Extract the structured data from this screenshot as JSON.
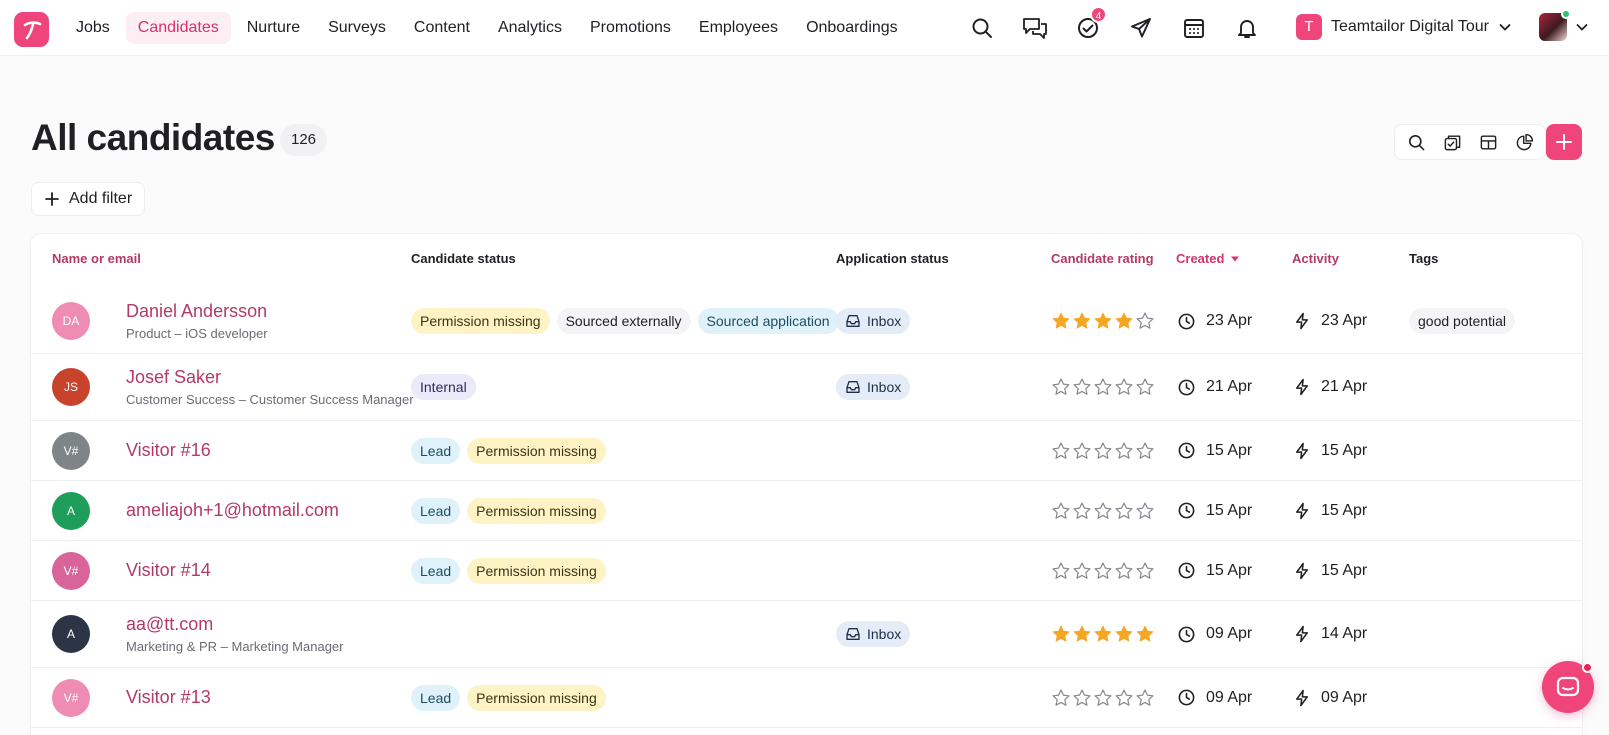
{
  "nav": {
    "items": [
      {
        "label": "Jobs",
        "active": false
      },
      {
        "label": "Candidates",
        "active": true
      },
      {
        "label": "Nurture",
        "active": false
      },
      {
        "label": "Surveys",
        "active": false
      },
      {
        "label": "Content",
        "active": false
      },
      {
        "label": "Analytics",
        "active": false
      },
      {
        "label": "Promotions",
        "active": false
      },
      {
        "label": "Employees",
        "active": false
      },
      {
        "label": "Onboardings",
        "active": false
      }
    ],
    "icons": [
      "search-icon",
      "messages-icon",
      "tasks-icon",
      "send-icon",
      "calendar-icon",
      "bell-icon"
    ],
    "tasks_badge": "4",
    "company_initial": "T",
    "company_name": "Teamtailor Digital Tour"
  },
  "page": {
    "title": "All candidates",
    "count": "126",
    "add_filter_label": "Add filter"
  },
  "colors": {
    "brand": "#f0457a",
    "accent_text": "#b33a62",
    "star_filled": "#f5a623"
  },
  "table": {
    "headers": {
      "name": "Name or email",
      "candidate_status": "Candidate status",
      "application_status": "Application status",
      "rating": "Candidate rating",
      "created": "Created",
      "activity": "Activity",
      "tags": "Tags"
    },
    "rows": [
      {
        "initials": "DA",
        "avatar_color": "#ee8cb3",
        "name": "Daniel Andersson",
        "sub": "Product – iOS developer",
        "statuses": [
          {
            "label": "Permission missing",
            "style": "yellow"
          },
          {
            "label": "Sourced externally",
            "style": "grey"
          },
          {
            "label": "Sourced application",
            "style": "cyan"
          }
        ],
        "application": "Inbox",
        "rating": 4,
        "created": "23 Apr",
        "activity": "23 Apr",
        "tag": "good potential"
      },
      {
        "initials": "JS",
        "avatar_color": "#c8432c",
        "name": "Josef Saker",
        "sub": "Customer Success – Customer Success Manager",
        "statuses": [
          {
            "label": "Internal",
            "style": "purple"
          }
        ],
        "application": "Inbox",
        "rating": 0,
        "created": "21 Apr",
        "activity": "21 Apr",
        "tag": ""
      },
      {
        "initials": "V#",
        "avatar_color": "#7e8587",
        "name": "Visitor #16",
        "sub": "",
        "statuses": [
          {
            "label": "Lead",
            "style": "cyan"
          },
          {
            "label": "Permission missing",
            "style": "yellow"
          }
        ],
        "application": "",
        "rating": 0,
        "created": "15 Apr",
        "activity": "15 Apr",
        "tag": ""
      },
      {
        "initials": "A",
        "avatar_color": "#1e9e5a",
        "name": "ameliajoh+1@hotmail.com",
        "sub": "",
        "statuses": [
          {
            "label": "Lead",
            "style": "cyan"
          },
          {
            "label": "Permission missing",
            "style": "yellow"
          }
        ],
        "application": "",
        "rating": 0,
        "created": "15 Apr",
        "activity": "15 Apr",
        "tag": ""
      },
      {
        "initials": "V#",
        "avatar_color": "#d9649a",
        "name": "Visitor #14",
        "sub": "",
        "statuses": [
          {
            "label": "Lead",
            "style": "cyan"
          },
          {
            "label": "Permission missing",
            "style": "yellow"
          }
        ],
        "application": "",
        "rating": 0,
        "created": "15 Apr",
        "activity": "15 Apr",
        "tag": ""
      },
      {
        "initials": "A",
        "avatar_color": "#2c3546",
        "name": "aa@tt.com",
        "sub": "Marketing & PR – Marketing Manager",
        "statuses": [],
        "application": "Inbox",
        "rating": 5,
        "created": "09 Apr",
        "activity": "14 Apr",
        "tag": ""
      },
      {
        "initials": "V#",
        "avatar_color": "#ee8cb3",
        "name": "Visitor #13",
        "sub": "",
        "statuses": [
          {
            "label": "Lead",
            "style": "cyan"
          },
          {
            "label": "Permission missing",
            "style": "yellow"
          }
        ],
        "application": "",
        "rating": 0,
        "created": "09 Apr",
        "activity": "09 Apr",
        "tag": ""
      }
    ]
  }
}
